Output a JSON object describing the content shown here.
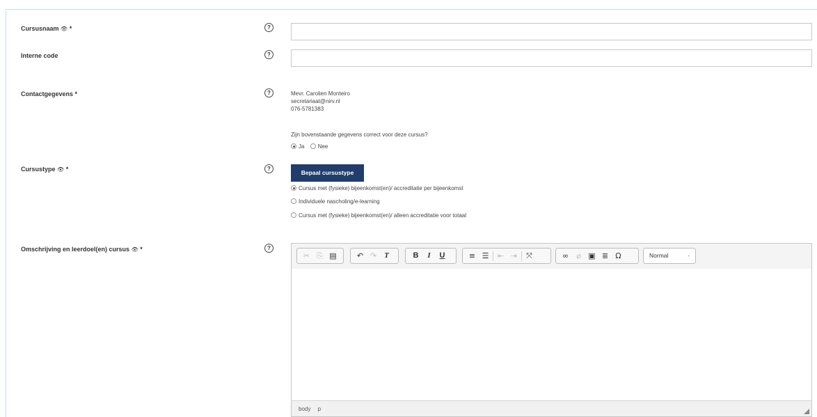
{
  "fields": {
    "cursusnaam": {
      "label": "Cursusnaam",
      "eye": "👁",
      "required": "*",
      "value": ""
    },
    "interne_code": {
      "label": "Interne code",
      "value": ""
    },
    "contact": {
      "label": "Contactgegevens",
      "required": "*",
      "name": "Mevr. Carolien Monteiro",
      "email": "secretariaat@nirv.nl",
      "phone": "076-5781383",
      "question": "Zijn bovenstaande gegevens correct voor deze cursus?",
      "options": [
        "Ja",
        "Nee"
      ],
      "selected": "Ja"
    },
    "cursustype": {
      "label": "Cursustype",
      "eye": "👁",
      "required": "*",
      "button": "Bepaal cursustype",
      "options": [
        "Cursus met (fysieke) bijeenkomst(en)/ accreditatie per bijeenkomst",
        "Individuele nascholing/e-learning",
        "Cursus met (fysieke) bijeenkomst(en)/ alleen accreditatie voor totaal"
      ],
      "selected_index": 0
    },
    "omschrijving": {
      "label": "Omschrijving en leerdoel(en) cursus",
      "eye": "👁",
      "required": "*"
    }
  },
  "help_glyph": "?",
  "editor": {
    "format_value": "Normal",
    "format_caret": "-",
    "status_path": [
      "body",
      "p"
    ],
    "toolbar_icons": [
      "cut-icon",
      "copy-icon",
      "paste-icon",
      "undo-icon",
      "redo-icon",
      "remove-format-icon",
      "bold-icon",
      "italic-icon",
      "underline-icon",
      "numbered-list-icon",
      "bulleted-list-icon",
      "outdent-icon",
      "indent-icon",
      "maximize-icon",
      "link-icon",
      "unlink-icon",
      "image-icon",
      "horizontal-line-icon",
      "special-char-icon"
    ]
  },
  "colors": {
    "primary_button": "#213d6b",
    "frame_border": "#c9dbe8"
  }
}
